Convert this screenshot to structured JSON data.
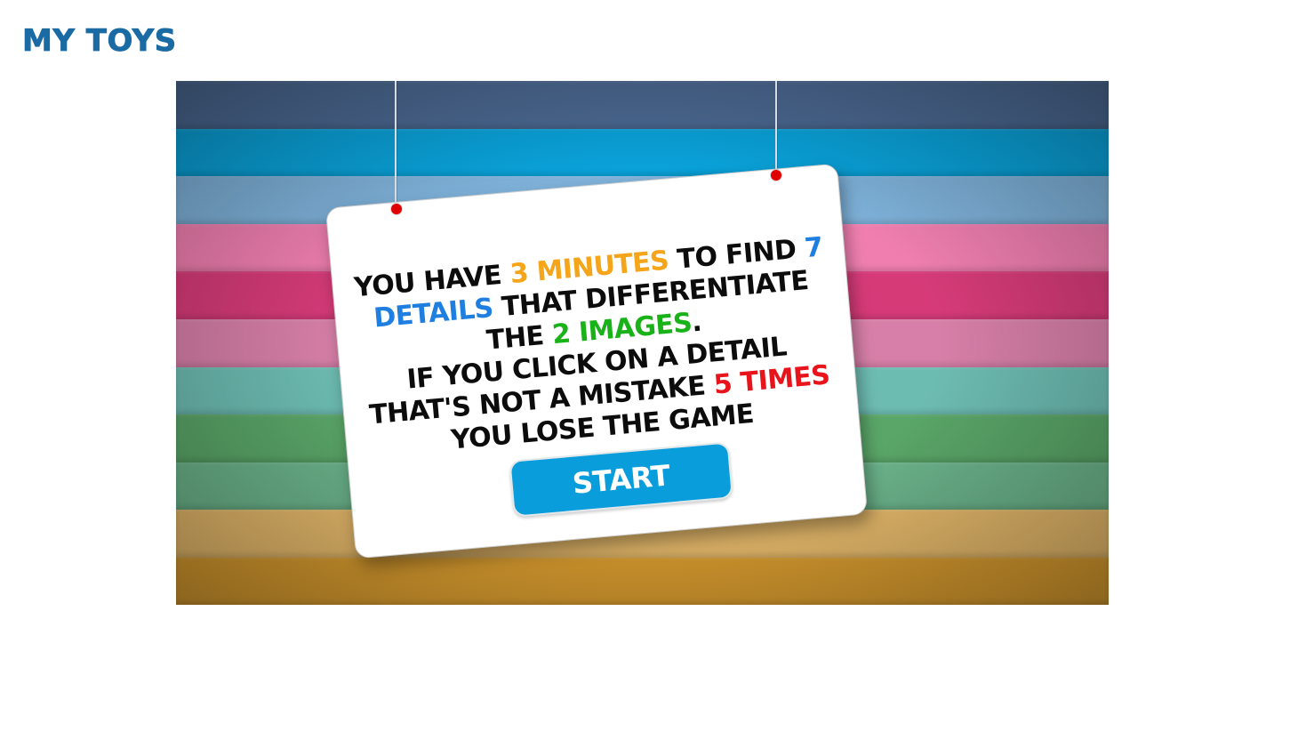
{
  "header": {
    "title": "MY TOYS"
  },
  "game": {
    "background_stripe_colors": [
      "#4d6b95",
      "#0aa4dc",
      "#7fb2da",
      "#f07fb0",
      "#d63b78",
      "#d77fa8",
      "#6dbcb2",
      "#5aa668",
      "#6bb38a",
      "#e4b86a",
      "#d69a2e"
    ],
    "instructions": {
      "part1": "YOU HAVE ",
      "minutes": "3 MINUTES",
      "part2": " TO FIND ",
      "details": "7 DETAILS",
      "part3": " THAT DIFFERENTIATE THE ",
      "images": "2 IMAGES",
      "part4": ".",
      "part5": "IF YOU CLICK ON A DETAIL THAT'S NOT A MISTAKE ",
      "times": "5 TIMES",
      "part6": " YOU LOSE THE GAME"
    },
    "start_label": "START",
    "highlight_colors": {
      "minutes": "#f5a51a",
      "details": "#1f7fe0",
      "images": "#19b319",
      "times": "#e8141c",
      "start_button": "#0a9ddc"
    }
  }
}
